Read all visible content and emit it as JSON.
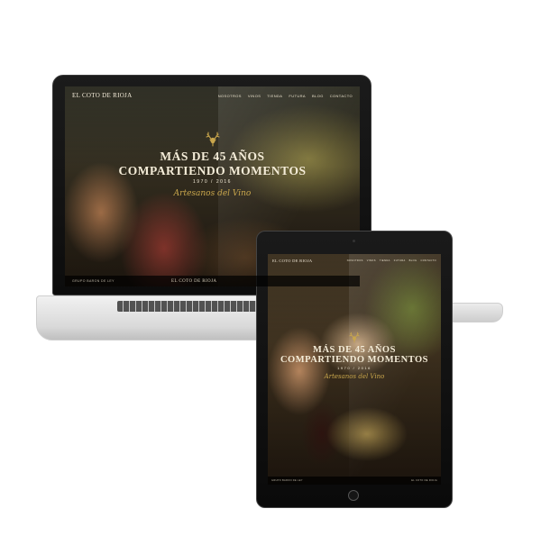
{
  "laptop": {
    "brand": "EL COTO DE RIOJA",
    "nav": [
      "NOSOTROS",
      "VINOS",
      "TIENDA",
      "FUTURA",
      "BLOG",
      "CONTACTO"
    ],
    "hero": {
      "line1": "MÁS DE 45 AÑOS",
      "line2": "COMPARTIENDO MOMENTOS",
      "years": "1970 / 2016",
      "tagline": "Artesanos del Vino"
    },
    "footer": {
      "left": "GRUPO BARON DE LEY",
      "center": "EL COTO DE RIOJA"
    }
  },
  "tablet": {
    "brand": "EL COTO DE RIOJA",
    "nav": [
      "NOSOTROS",
      "VINOS",
      "TIENDA",
      "FUTURA",
      "BLOG",
      "CONTACTO"
    ],
    "hero": {
      "line1": "MÁS DE 45 AÑOS",
      "line2": "COMPARTIENDO MOMENTOS",
      "years": "1970 / 2016",
      "tagline": "Artesanos del Vino"
    },
    "footer": {
      "left": "GRUPO BARON DE LEY",
      "center": "EL COTO DE RIOJA"
    }
  },
  "colors": {
    "gold": "#c9a64c",
    "cream": "#f4ecd8"
  },
  "icons": {
    "deer": "deer-crest-icon",
    "home": "home-button-icon"
  }
}
